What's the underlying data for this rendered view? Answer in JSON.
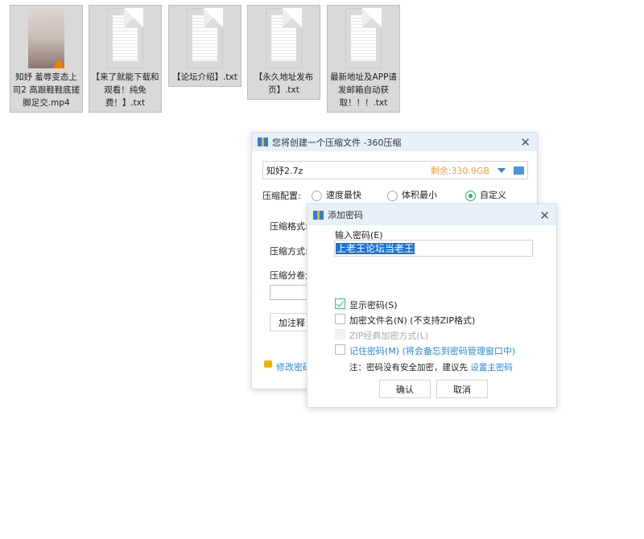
{
  "files": [
    {
      "name": "知妤 羞辱变态上司2 高跟鞋鞋底搓脚足交.mp4",
      "type": "video"
    },
    {
      "name": "【来了就能下载和观看！纯免费！】.txt",
      "type": "txt"
    },
    {
      "name": "【论坛介绍】.txt",
      "type": "txt"
    },
    {
      "name": "【永久地址发布页】.txt",
      "type": "txt"
    },
    {
      "name": "最新地址及APP请发邮箱自动获取！！！.txt",
      "type": "txt"
    }
  ],
  "main_dialog": {
    "title": "您将创建一个压缩文件 -360压缩",
    "filename": "知妤2.7z",
    "free_space": "剩余:330.9GB",
    "config_label": "压缩配置:",
    "options": [
      "速度最快",
      "体积最小",
      "自定义"
    ],
    "selected_option": "自定义",
    "format_label": "压缩格式:",
    "method_label": "压缩方式:",
    "split_label": "压缩分卷大",
    "comment_button": "加注释",
    "change_password": "修改密码",
    "accent": "#2eb36b",
    "free_color": "#f0a030"
  },
  "password_dialog": {
    "title": "添加密码",
    "input_label": "输入密码(E)",
    "password_value": "上老王论坛当老王",
    "show_password": "显示密码(S)",
    "encrypt_names": "加密文件名(N) (不支持ZIP格式)",
    "zip_classic": "ZIP经典加密方式(L)",
    "remember": "记住密码(M) (将会备忘到密码管理窗口中)",
    "note": "注：密码没有安全加密，建议先",
    "note_link": "设置主密码",
    "ok": "确认",
    "cancel": "取消"
  }
}
